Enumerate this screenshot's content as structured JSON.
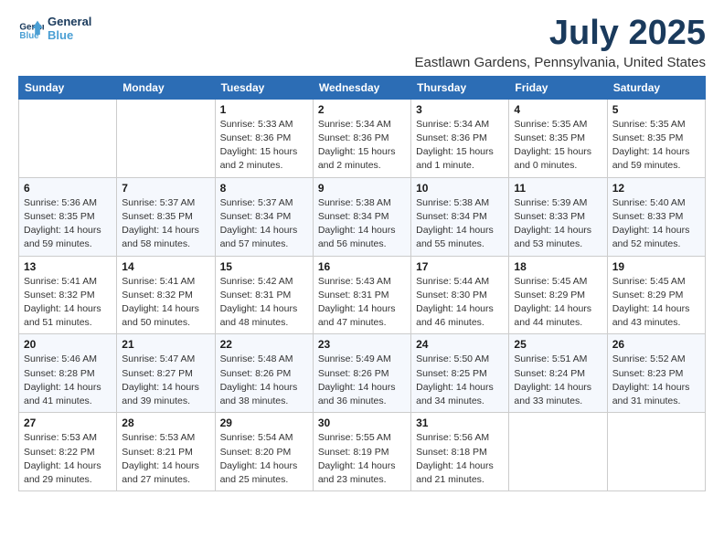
{
  "header": {
    "logo_line1": "General",
    "logo_line2": "Blue",
    "title": "July 2025",
    "subtitle": "Eastlawn Gardens, Pennsylvania, United States"
  },
  "days_of_week": [
    "Sunday",
    "Monday",
    "Tuesday",
    "Wednesday",
    "Thursday",
    "Friday",
    "Saturday"
  ],
  "weeks": [
    [
      {
        "day": "",
        "info": ""
      },
      {
        "day": "",
        "info": ""
      },
      {
        "day": "1",
        "info": "Sunrise: 5:33 AM\nSunset: 8:36 PM\nDaylight: 15 hours\nand 2 minutes."
      },
      {
        "day": "2",
        "info": "Sunrise: 5:34 AM\nSunset: 8:36 PM\nDaylight: 15 hours\nand 2 minutes."
      },
      {
        "day": "3",
        "info": "Sunrise: 5:34 AM\nSunset: 8:36 PM\nDaylight: 15 hours\nand 1 minute."
      },
      {
        "day": "4",
        "info": "Sunrise: 5:35 AM\nSunset: 8:35 PM\nDaylight: 15 hours\nand 0 minutes."
      },
      {
        "day": "5",
        "info": "Sunrise: 5:35 AM\nSunset: 8:35 PM\nDaylight: 14 hours\nand 59 minutes."
      }
    ],
    [
      {
        "day": "6",
        "info": "Sunrise: 5:36 AM\nSunset: 8:35 PM\nDaylight: 14 hours\nand 59 minutes."
      },
      {
        "day": "7",
        "info": "Sunrise: 5:37 AM\nSunset: 8:35 PM\nDaylight: 14 hours\nand 58 minutes."
      },
      {
        "day": "8",
        "info": "Sunrise: 5:37 AM\nSunset: 8:34 PM\nDaylight: 14 hours\nand 57 minutes."
      },
      {
        "day": "9",
        "info": "Sunrise: 5:38 AM\nSunset: 8:34 PM\nDaylight: 14 hours\nand 56 minutes."
      },
      {
        "day": "10",
        "info": "Sunrise: 5:38 AM\nSunset: 8:34 PM\nDaylight: 14 hours\nand 55 minutes."
      },
      {
        "day": "11",
        "info": "Sunrise: 5:39 AM\nSunset: 8:33 PM\nDaylight: 14 hours\nand 53 minutes."
      },
      {
        "day": "12",
        "info": "Sunrise: 5:40 AM\nSunset: 8:33 PM\nDaylight: 14 hours\nand 52 minutes."
      }
    ],
    [
      {
        "day": "13",
        "info": "Sunrise: 5:41 AM\nSunset: 8:32 PM\nDaylight: 14 hours\nand 51 minutes."
      },
      {
        "day": "14",
        "info": "Sunrise: 5:41 AM\nSunset: 8:32 PM\nDaylight: 14 hours\nand 50 minutes."
      },
      {
        "day": "15",
        "info": "Sunrise: 5:42 AM\nSunset: 8:31 PM\nDaylight: 14 hours\nand 48 minutes."
      },
      {
        "day": "16",
        "info": "Sunrise: 5:43 AM\nSunset: 8:31 PM\nDaylight: 14 hours\nand 47 minutes."
      },
      {
        "day": "17",
        "info": "Sunrise: 5:44 AM\nSunset: 8:30 PM\nDaylight: 14 hours\nand 46 minutes."
      },
      {
        "day": "18",
        "info": "Sunrise: 5:45 AM\nSunset: 8:29 PM\nDaylight: 14 hours\nand 44 minutes."
      },
      {
        "day": "19",
        "info": "Sunrise: 5:45 AM\nSunset: 8:29 PM\nDaylight: 14 hours\nand 43 minutes."
      }
    ],
    [
      {
        "day": "20",
        "info": "Sunrise: 5:46 AM\nSunset: 8:28 PM\nDaylight: 14 hours\nand 41 minutes."
      },
      {
        "day": "21",
        "info": "Sunrise: 5:47 AM\nSunset: 8:27 PM\nDaylight: 14 hours\nand 39 minutes."
      },
      {
        "day": "22",
        "info": "Sunrise: 5:48 AM\nSunset: 8:26 PM\nDaylight: 14 hours\nand 38 minutes."
      },
      {
        "day": "23",
        "info": "Sunrise: 5:49 AM\nSunset: 8:26 PM\nDaylight: 14 hours\nand 36 minutes."
      },
      {
        "day": "24",
        "info": "Sunrise: 5:50 AM\nSunset: 8:25 PM\nDaylight: 14 hours\nand 34 minutes."
      },
      {
        "day": "25",
        "info": "Sunrise: 5:51 AM\nSunset: 8:24 PM\nDaylight: 14 hours\nand 33 minutes."
      },
      {
        "day": "26",
        "info": "Sunrise: 5:52 AM\nSunset: 8:23 PM\nDaylight: 14 hours\nand 31 minutes."
      }
    ],
    [
      {
        "day": "27",
        "info": "Sunrise: 5:53 AM\nSunset: 8:22 PM\nDaylight: 14 hours\nand 29 minutes."
      },
      {
        "day": "28",
        "info": "Sunrise: 5:53 AM\nSunset: 8:21 PM\nDaylight: 14 hours\nand 27 minutes."
      },
      {
        "day": "29",
        "info": "Sunrise: 5:54 AM\nSunset: 8:20 PM\nDaylight: 14 hours\nand 25 minutes."
      },
      {
        "day": "30",
        "info": "Sunrise: 5:55 AM\nSunset: 8:19 PM\nDaylight: 14 hours\nand 23 minutes."
      },
      {
        "day": "31",
        "info": "Sunrise: 5:56 AM\nSunset: 8:18 PM\nDaylight: 14 hours\nand 21 minutes."
      },
      {
        "day": "",
        "info": ""
      },
      {
        "day": "",
        "info": ""
      }
    ]
  ]
}
